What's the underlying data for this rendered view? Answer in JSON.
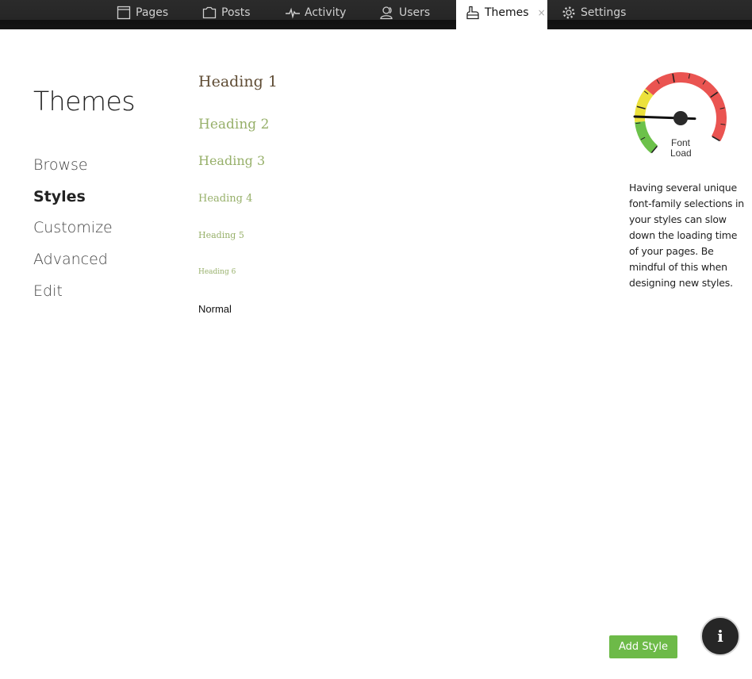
{
  "nav": {
    "tabs": [
      {
        "label": "Pages",
        "icon": "page-icon"
      },
      {
        "label": "Posts",
        "icon": "folder-icon"
      },
      {
        "label": "Activity",
        "icon": "pulse-icon"
      },
      {
        "label": "Users",
        "icon": "users-icon"
      },
      {
        "label": "Themes",
        "icon": "brush-icon",
        "active": true
      },
      {
        "label": "Settings",
        "icon": "gear-icon"
      }
    ],
    "close_glyph": "×"
  },
  "sidebar": {
    "title": "Themes",
    "items": [
      {
        "label": "Browse"
      },
      {
        "label": "Styles",
        "active": true
      },
      {
        "label": "Customize"
      },
      {
        "label": "Advanced"
      },
      {
        "label": "Edit"
      }
    ]
  },
  "styles": {
    "h1": "Heading 1",
    "h2": "Heading 2",
    "h3": "Heading 3",
    "h4": "Heading 4",
    "h5": "Heading 5",
    "h6": "Heading 6",
    "normal": "Normal"
  },
  "gauge": {
    "label_line1": "Font",
    "label_line2": "Load",
    "level": 0.2,
    "colors": {
      "green": "#6cc14a",
      "yellow": "#ece13c",
      "red": "#ea5451"
    },
    "note": "Having several unique font-family selections in your styles can slow down the loading time of your pages. Be mindful of this when designing new styles."
  },
  "actions": {
    "add_style": "Add Style",
    "info_glyph": "i"
  },
  "colors": {
    "accent_green": "#6dba48",
    "heading1": "#5e4b33",
    "heading_other": "#97b06a",
    "topbar": "#262626"
  }
}
